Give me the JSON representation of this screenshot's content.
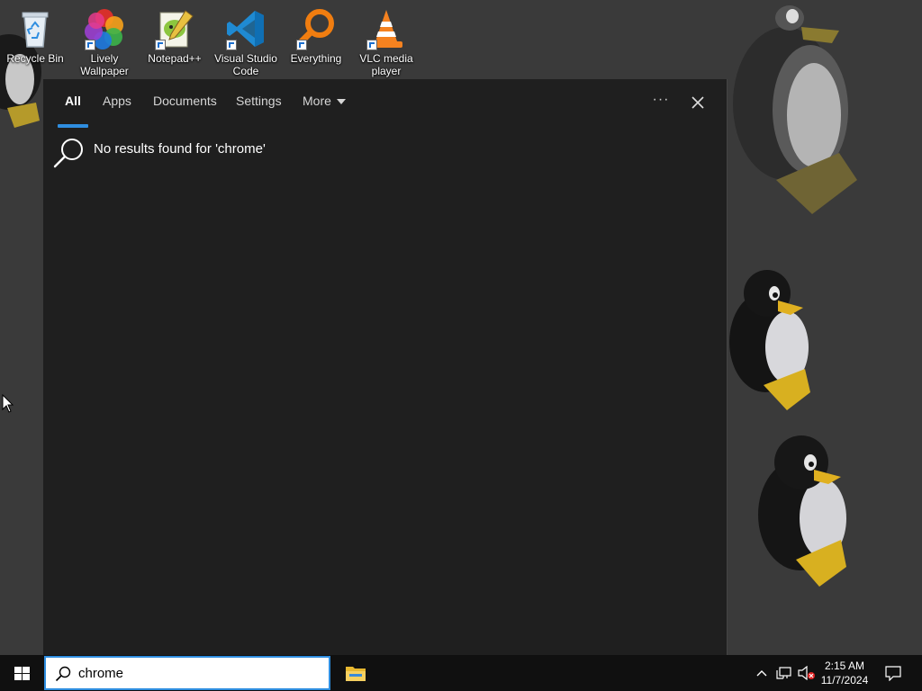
{
  "desktop": {
    "icons": [
      {
        "label": "Recycle Bin",
        "icon": "recycle-bin-icon"
      },
      {
        "label": "Lively Wallpaper",
        "icon": "lively-wallpaper-icon"
      },
      {
        "label": "Notepad++",
        "icon": "notepad-plus-plus-icon"
      },
      {
        "label": "Visual Studio Code",
        "icon": "vscode-icon"
      },
      {
        "label": "Everything",
        "icon": "everything-search-icon"
      },
      {
        "label": "VLC media player",
        "icon": "vlc-icon"
      }
    ]
  },
  "search_panel": {
    "tabs": [
      {
        "label": "All",
        "active": true
      },
      {
        "label": "Apps"
      },
      {
        "label": "Documents"
      },
      {
        "label": "Settings"
      },
      {
        "label": "More"
      }
    ],
    "more_options_label": "···",
    "no_results_text": "No results found for 'chrome'"
  },
  "taskbar": {
    "search_value": "chrome",
    "clock_time": "2:15 AM",
    "clock_date": "11/7/2024"
  },
  "colors": {
    "accent": "#2f8ee0",
    "panel_bg": "#1f1f1f",
    "taskbar_bg": "#101010",
    "desktop_bg": "#3a3a3a"
  }
}
